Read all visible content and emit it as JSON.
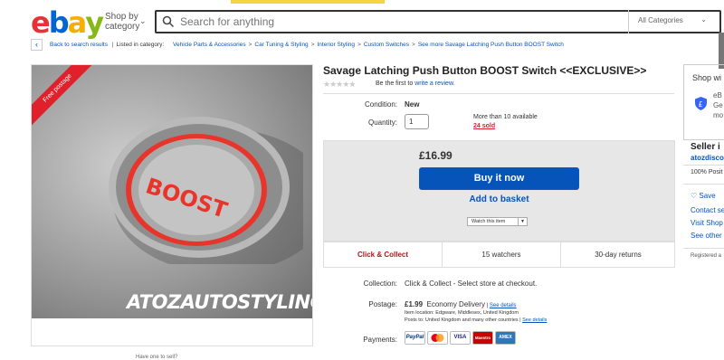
{
  "header": {
    "logo_letters": [
      "e",
      "b",
      "a",
      "y"
    ],
    "logo_colors": [
      "#e53238",
      "#0064d2",
      "#f5af02",
      "#86b817"
    ],
    "shop_by_line1": "Shop by",
    "shop_by_line2": "category",
    "search_placeholder": "Search for anything",
    "category_select": "All Categories"
  },
  "breadcrumb": {
    "back_label": "Back to search results",
    "listed_in": "Listed in category:",
    "items": [
      "Vehicle Parts & Accessories",
      "Car Tuning & Styling",
      "Interior Styling",
      "Custom Switches",
      "See more Savage Latching Push Button BOOST Switch"
    ]
  },
  "gallery": {
    "ribbon": "Free postage",
    "knob_text": "BOOST",
    "watermark": "ATOZAUTOSTYLING",
    "caption": "Have one to sell?"
  },
  "item": {
    "title": "Savage Latching Push Button BOOST Switch <<EXCLUSIVE>>",
    "review_prefix": "Be the first to",
    "review_link": "write a review.",
    "condition_label": "Condition:",
    "condition_value": "New",
    "quantity_label": "Quantity:",
    "quantity_value": "1",
    "available": "More than 10 available",
    "sold": "24 sold",
    "price": "£16.99",
    "buy_now": "Buy it now",
    "add_basket": "Add to basket",
    "watch": "Watch this item"
  },
  "tabs": [
    "Click & Collect",
    "15 watchers",
    "30-day returns"
  ],
  "details": {
    "collection_label": "Collection:",
    "collection_value": "Click & Collect - Select store at checkout.",
    "postage_label": "Postage:",
    "postage_price": "£1.99",
    "postage_method": "Economy Delivery",
    "postage_sep": " | ",
    "see_details": "See details",
    "item_location": "Item location:  Edgware, Middlesex, United Kingdom",
    "posts_to": "Posts to:  United Kingdom and many other countries |",
    "payments_label": "Payments:",
    "payment_cards": [
      "PayPal",
      "MC",
      "VISA",
      "Maestro",
      "AMEX"
    ]
  },
  "right_panel": {
    "heading": "Shop wi",
    "ebay_line1": "eB",
    "ebay_line2": "Ge",
    "ebay_line3": "mo",
    "seller_title": "Seller i",
    "seller_name": "atozdisco",
    "positive": "100% Posit",
    "save": "Save",
    "contact": "Contact se",
    "visit": "Visit Shop",
    "see_other": "See other",
    "registered": "Registered a"
  }
}
